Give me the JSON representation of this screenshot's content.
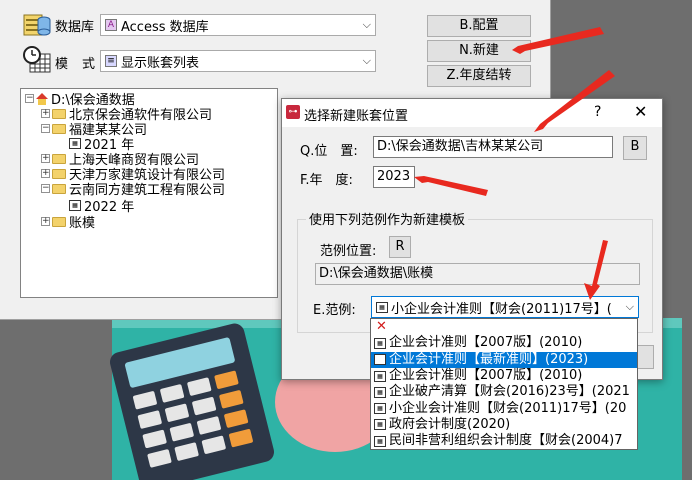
{
  "main": {
    "db_label": "数据库",
    "db_value": "Access 数据库",
    "mode_label_1": "模",
    "mode_label_2": "式",
    "mode_value": "显示账套列表",
    "buttons": {
      "config": "B.配置",
      "new": "N.新建",
      "year_end": "Z.年度结转"
    }
  },
  "tree": {
    "root": "D:\\保会通数据",
    "nodes": [
      {
        "label": "北京保会通软件有限公司",
        "state": "+"
      },
      {
        "label": "福建某某公司",
        "state": "-"
      },
      {
        "label": "2021 年",
        "state": "leaf"
      },
      {
        "label": "上海天峰商贸有限公司",
        "state": "+"
      },
      {
        "label": "天津万家建筑设计有限公司",
        "state": "+"
      },
      {
        "label": "云南同方建筑工程有限公司",
        "state": "-"
      },
      {
        "label": "2022 年",
        "state": "leaf"
      },
      {
        "label": "账模",
        "state": "+"
      }
    ]
  },
  "dialog": {
    "title": "选择新建账套位置",
    "help": "?",
    "close": "✕",
    "position_label": "Q.位　置:",
    "position_value": "D:\\保会通数据\\吉林某某公司",
    "browse_button": "B",
    "year_label": "F.年　度:",
    "year_value": "2023",
    "group_title": "使用下列范例作为新建模板",
    "template_pos_label": "范例位置:",
    "template_pos_button": "R",
    "template_pos_value": "D:\\保会通数据\\账模",
    "template_label": "E.范例:",
    "template_value": "小企业会计准则【财会(2011)17号】(",
    "template_icon": "calendar-icon"
  },
  "dropdown": {
    "items": [
      {
        "label": "企业会计准则【2007版】(2010)",
        "selected": false
      },
      {
        "label": "企业会计准则【最新准则】(2023)",
        "selected": true
      },
      {
        "label": "企业会计准则【2007版】(2010)",
        "selected": false
      },
      {
        "label": "企业破产清算【财会(2016)23号】(2021",
        "selected": false
      },
      {
        "label": "小企业会计准则【财会(2011)17号】(20",
        "selected": false
      },
      {
        "label": "政府会计制度(2020)",
        "selected": false
      },
      {
        "label": "民间非营利组织会计制度【财会(2004)7",
        "selected": false
      }
    ]
  },
  "colors": {
    "arrow": "#e8291f",
    "selection": "#0078d7",
    "teal": "#2fb3a6"
  }
}
